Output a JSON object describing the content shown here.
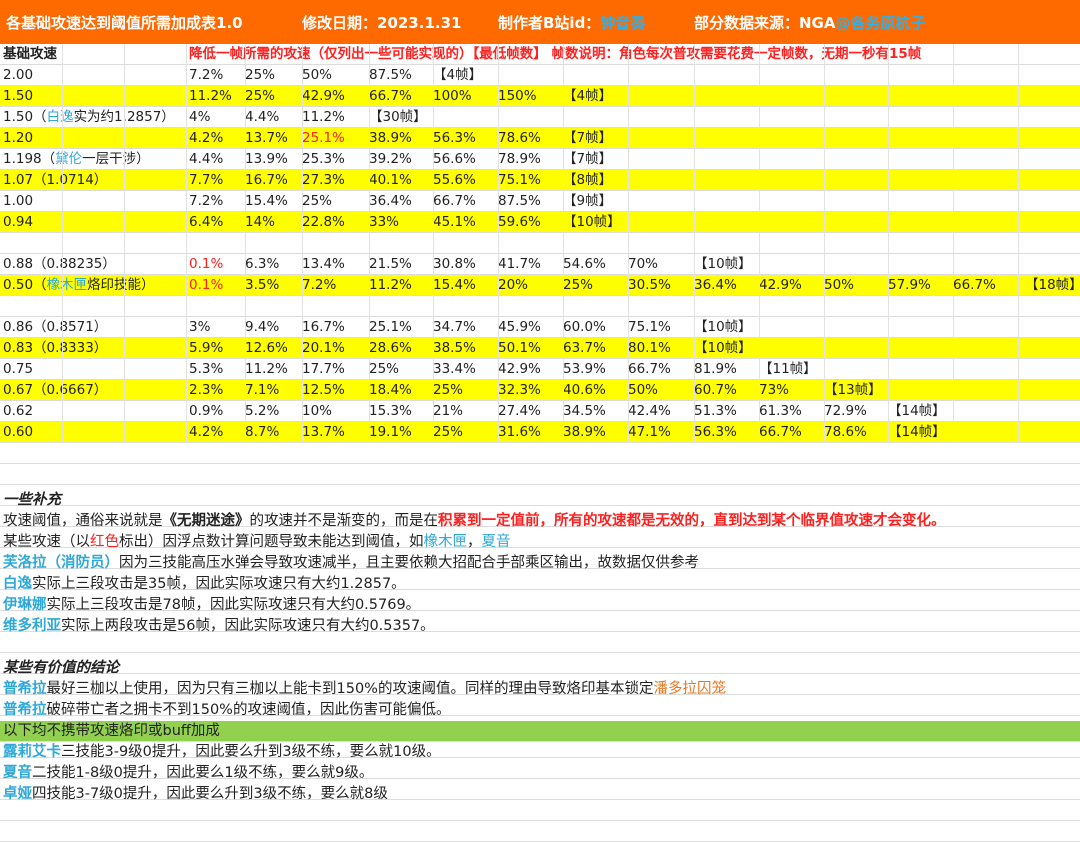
{
  "banner": {
    "title": "各基础攻速达到阈值所需加成表1.0",
    "date": "修改日期：2023.1.31",
    "author_label": "制作者B站id：",
    "author_name": "钟音奏",
    "source_label": "部分数据来源：NGA",
    "source_name": "@各务原杭子"
  },
  "header": {
    "col_a": "基础攻速",
    "desc": "降低一帧所需的攻速（仅列出一些可能实现的）【最低帧数】 帧数说明：角色每次普攻需要花费一定帧数，无期一秒有15帧"
  },
  "rows": [
    {
      "base": "2.00",
      "vals": [
        "7.2%",
        "25%",
        "50%",
        "87.5%",
        "【4帧】"
      ],
      "style": "white"
    },
    {
      "base": "1.50",
      "vals": [
        "11.2%",
        "25%",
        "42.9%",
        "66.7%",
        "100%",
        "150%",
        "【4帧】"
      ],
      "style": "yellow"
    },
    {
      "base_pre": "1.50（",
      "base_name": "白逸",
      "base_post": "实为约1.2857）",
      "vals": [
        "4%",
        "4.4%",
        "11.2%",
        "【30帧】"
      ],
      "style": "white"
    },
    {
      "base": "1.20",
      "vals": [
        "4.2%",
        "13.7%",
        "25.1%",
        "38.9%",
        "56.3%",
        "78.6%",
        "【7帧】"
      ],
      "red_idx": 2,
      "style": "yellow"
    },
    {
      "base_pre": "1.198（",
      "base_name": "黛伦",
      "base_post": "一层干涉）",
      "vals": [
        "4.4%",
        "13.9%",
        "25.3%",
        "39.2%",
        "56.6%",
        "78.9%",
        "【7帧】"
      ],
      "style": "white"
    },
    {
      "base": "1.07（1.0714）",
      "vals": [
        "7.7%",
        "16.7%",
        "27.3%",
        "40.1%",
        "55.6%",
        "75.1%",
        "【8帧】"
      ],
      "style": "yellow"
    },
    {
      "base": "1.00",
      "vals": [
        "7.2%",
        "15.4%",
        "25%",
        "36.4%",
        "66.7%",
        "87.5%",
        "【9帧】"
      ],
      "style": "white"
    },
    {
      "base": "0.94",
      "vals": [
        "6.4%",
        "14%",
        "22.8%",
        "33%",
        "45.1%",
        "59.6%",
        "【10帧】"
      ],
      "style": "yellow"
    },
    {
      "base": "",
      "vals": [],
      "style": "white"
    },
    {
      "base": "0.88（0.88235）",
      "vals": [
        "0.1%",
        "6.3%",
        "13.4%",
        "21.5%",
        "30.8%",
        "41.7%",
        "54.6%",
        "70%",
        "【10帧】"
      ],
      "red_idx": 0,
      "style": "white"
    },
    {
      "base_pre": "0.50（",
      "base_name": "橡木匣",
      "base_post": "烙印技能）",
      "vals": [
        "0.1%",
        "3.5%",
        "7.2%",
        "11.2%",
        "15.4%",
        "20%",
        "25%",
        "30.5%",
        "36.4%",
        "42.9%",
        "50%",
        "57.9%",
        "66.7%",
        "【18帧】"
      ],
      "red_idx": 0,
      "style": "yellow"
    },
    {
      "base": "",
      "vals": [],
      "style": "white"
    },
    {
      "base": "0.86（0.8571）",
      "vals": [
        "3%",
        "9.4%",
        "16.7%",
        "25.1%",
        "34.7%",
        "45.9%",
        "60.0%",
        "75.1%",
        "【10帧】"
      ],
      "style": "white"
    },
    {
      "base": "0.83（0.8333）",
      "vals": [
        "5.9%",
        "12.6%",
        "20.1%",
        "28.6%",
        "38.5%",
        "50.1%",
        "63.7%",
        "80.1%",
        "【10帧】"
      ],
      "style": "yellow"
    },
    {
      "base": "0.75",
      "vals": [
        "5.3%",
        "11.2%",
        "17.7%",
        "25%",
        "33.4%",
        "42.9%",
        "53.9%",
        "66.7%",
        "81.9%",
        "【11帧】"
      ],
      "style": "white"
    },
    {
      "base": "0.67（0.6667）",
      "vals": [
        "2.3%",
        "7.1%",
        "12.5%",
        "18.4%",
        "25%",
        "32.3%",
        "40.6%",
        "50%",
        "60.7%",
        "73%",
        "【13帧】"
      ],
      "style": "yellow"
    },
    {
      "base": "0.62",
      "vals": [
        "0.9%",
        "5.2%",
        "10%",
        "15.3%",
        "21%",
        "27.4%",
        "34.5%",
        "42.4%",
        "51.3%",
        "61.3%",
        "72.9%",
        "【14帧】"
      ],
      "style": "white"
    },
    {
      "base": "0.60",
      "vals": [
        "4.2%",
        "8.7%",
        "13.7%",
        "19.1%",
        "25%",
        "31.6%",
        "38.9%",
        "47.1%",
        "56.3%",
        "66.7%",
        "78.6%",
        "【14帧】"
      ],
      "style": "yellow"
    }
  ],
  "notes": {
    "supp_title": "一些补充",
    "n1_a": "攻速阈值，通俗来说就是",
    "n1_b": "《无期迷途》",
    "n1_c": "的攻速并不是渐变的，而是在",
    "n1_d": "积累到一定值前，所有的攻速都是无效的，直到达到某个临界值攻速才会变化。",
    "n2_a": "某些攻速（以",
    "n2_b": "红色",
    "n2_c": "标出）因浮点数计算问题导致未能达到阈值，如",
    "n2_d": "橡木匣",
    "n2_e": "，",
    "n2_f": "夏音",
    "n3_a": "芙洛拉（消防员）",
    "n3_b": "因为三技能高压水弹会导致攻速减半，且主要依赖大招配合手部乘区输出，故数据仅供参考",
    "n4_a": "白逸",
    "n4_b": "实际上三段攻击是35帧，因此实际攻速只有大约1.2857。",
    "n5_a": "伊琳娜",
    "n5_b": "实际上三段攻击是78帧，因此实际攻速只有大约0.5769。",
    "n6_a": "维多利亚",
    "n6_b": "实际上两段攻击是56帧，因此实际攻速只有大约0.5357。",
    "concl_title": "某些有价值的结论",
    "c1_a": "普希拉",
    "c1_b": "最好三枷以上使用，因为只有三枷以上能卡到150%的攻速阈值。同样的理由导致烙印基本锁定",
    "c1_c": "潘多拉囚笼",
    "c2_a": "普希拉",
    "c2_b": "破碎带亡者之拥卡不到150%的攻速阈值，因此伤害可能偏低。",
    "green_note": "以下均不携带攻速烙印或buff加成",
    "c3_a": "露莉艾卡",
    "c3_b": "三技能3-9级0提升，因此要么升到3级不练，要么就10级。",
    "c4_a": "夏音",
    "c4_b": "二技能1-8级0提升，因此要么1级不练，要么就9级。",
    "c5_a": "卓娅",
    "c5_b": "四技能3-7级0提升，因此要么升到3级不练，要么就8级"
  },
  "colors": {
    "banner": "#ff6a00",
    "highlight_yellow": "#ffff00",
    "green": "#92d050",
    "red_text": "#ff2020",
    "blue_text": "#2fa8d8",
    "orange_text": "#e87722"
  }
}
